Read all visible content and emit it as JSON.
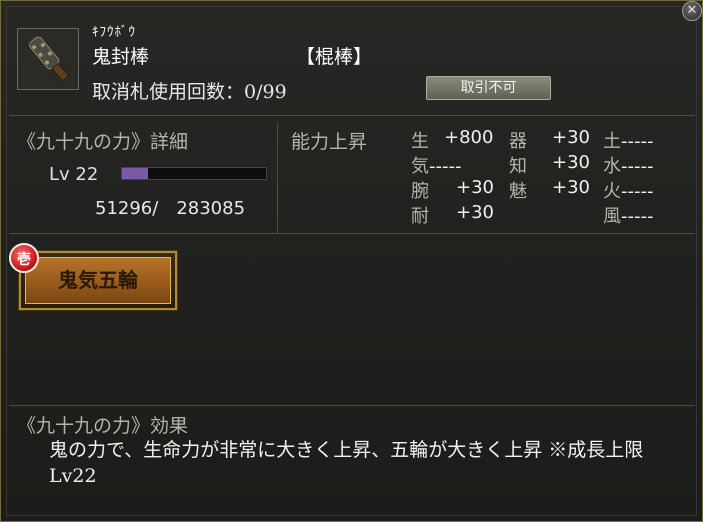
{
  "window": {
    "close_glyph": "✕",
    "close_icon": "close-icon"
  },
  "item": {
    "icon": "kanabo-club-icon",
    "furigana": "ｷﾌｳﾎﾞｳ",
    "name": "鬼封棒",
    "type": "【棍棒】",
    "uses_label": "取消札使用回数：0/99",
    "trade_badge": "取引不可"
  },
  "detail": {
    "title": "《九十九の力》詳細",
    "level": "Lv 22",
    "exp_progress": 0.18,
    "exp_text": "51296/　283085",
    "accent_color": "#7a5aa7"
  },
  "ability": {
    "title": "能力上昇",
    "stats": [
      {
        "key": "生",
        "value": "+800"
      },
      {
        "key": "器",
        "value": "+30"
      },
      {
        "key": "土",
        "value": "-----"
      },
      {
        "key": "気",
        "value": "-----"
      },
      {
        "key": "知",
        "value": "+30"
      },
      {
        "key": "水",
        "value": "-----"
      },
      {
        "key": "腕",
        "value": "+30"
      },
      {
        "key": "魅",
        "value": "+30"
      },
      {
        "key": "火",
        "value": "-----"
      },
      {
        "key": "耐",
        "value": "+30"
      },
      {
        "key": "風",
        "value": "-----"
      }
    ]
  },
  "skill": {
    "badge": "壱",
    "name": "鬼気五輪",
    "badge_color": "#c01212"
  },
  "effect": {
    "title": "《九十九の力》効果",
    "body": "鬼の力で、生命力が非常に大きく上昇、五輪が大きく上昇 ※成長上限Lv22"
  }
}
